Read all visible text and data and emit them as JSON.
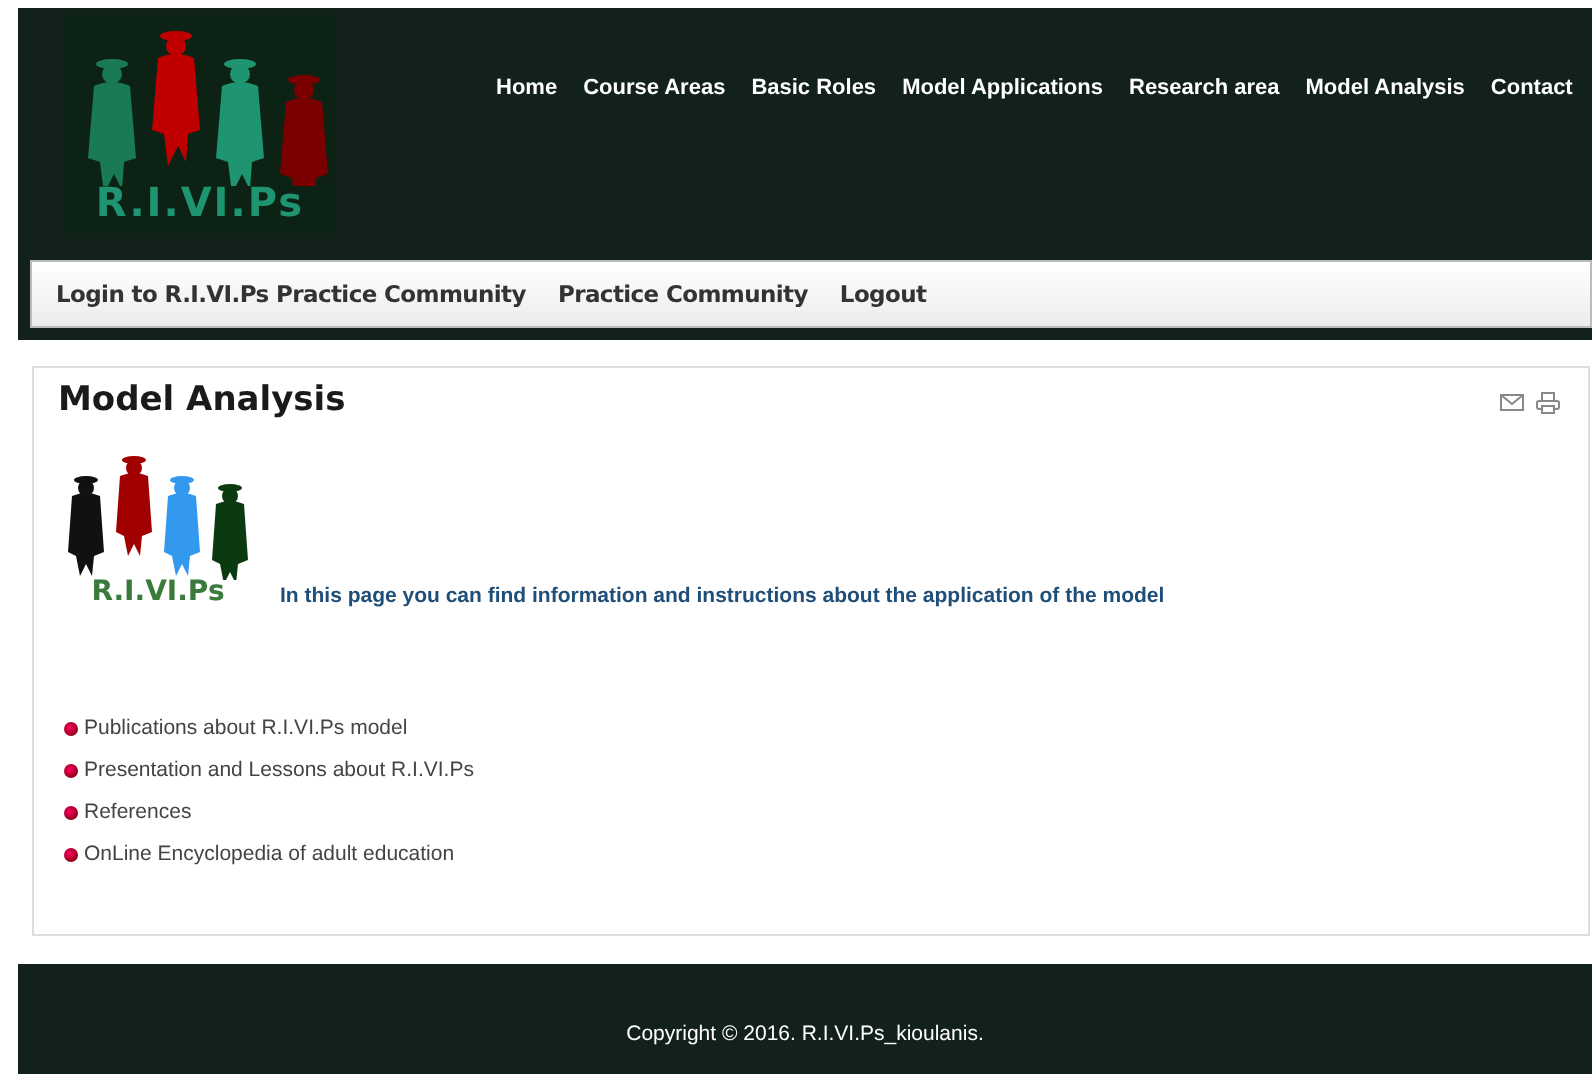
{
  "header": {
    "logo_text": "R.I.VI.Ps",
    "nav": [
      "Home",
      "Course Areas",
      "Basic Roles",
      "Model Applications",
      "Research area",
      "Model Analysis",
      "Contact"
    ]
  },
  "subnav": [
    "Login to R.I.VI.Ps Practice Community",
    "Practice Community",
    "Logout"
  ],
  "article": {
    "title": "Model Analysis",
    "logo_text": "R.I.VI.Ps",
    "intro": "In this page you can find information and instructions about the application of the model",
    "links": [
      "Publications about R.I.VI.Ps model",
      "Presentation and Lessons about R.I.VI.Ps",
      "References",
      "OnLine Encyclopedia of adult education"
    ]
  },
  "footer": {
    "copyright": "Copyright © 2016. R.I.VI.Ps_kioulanis."
  }
}
